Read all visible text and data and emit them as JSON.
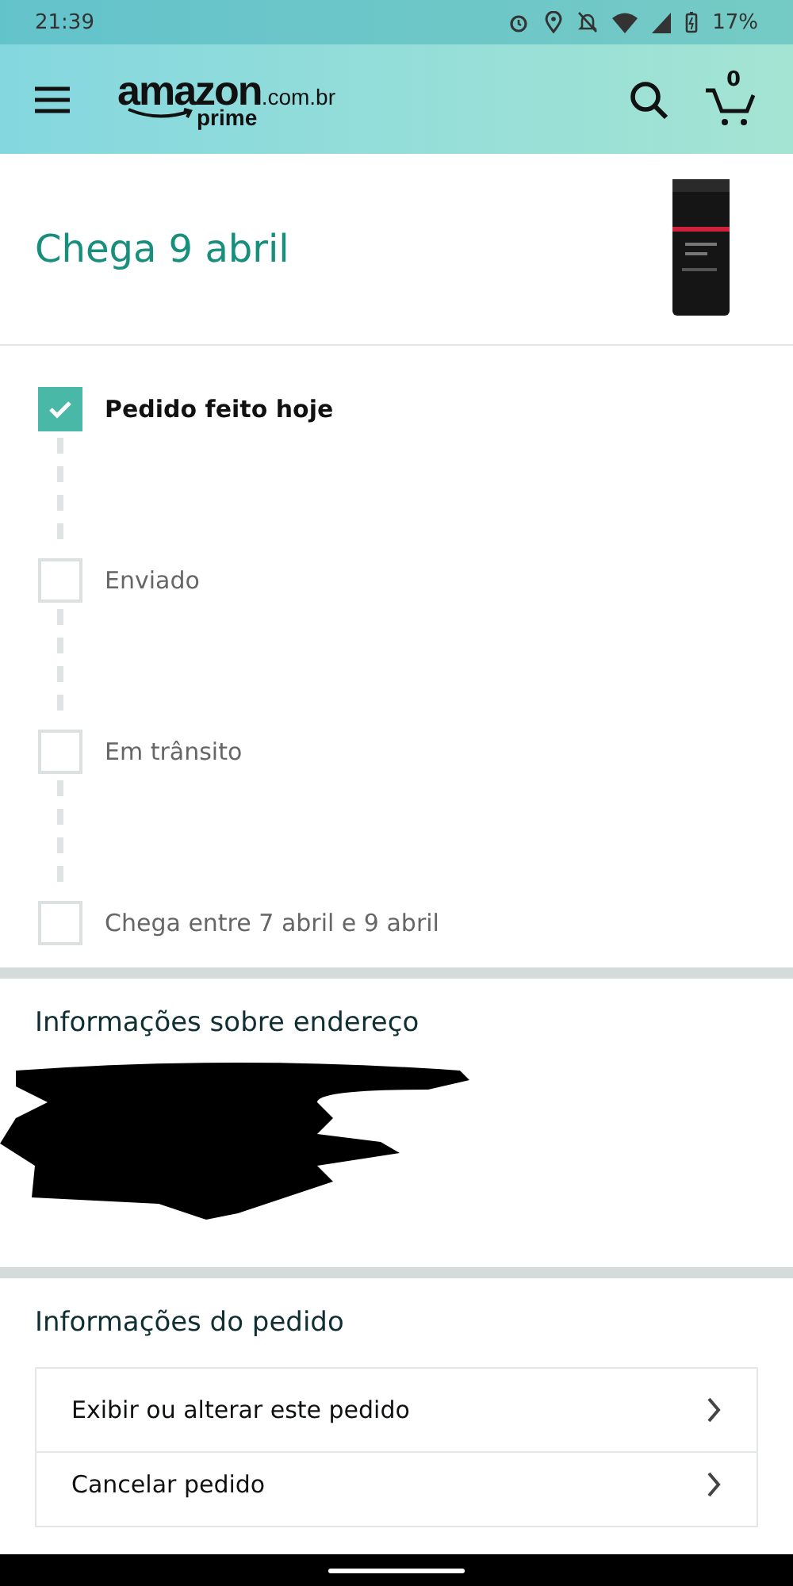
{
  "status_bar": {
    "time": "21:39",
    "battery": "17%"
  },
  "header": {
    "logo": {
      "word": "amazon",
      "domain": ".com.br",
      "tier": "prime"
    },
    "cart_count": "0"
  },
  "delivery": {
    "title": "Chega 9 abril"
  },
  "tracking": [
    {
      "label": "Pedido feito hoje",
      "checked": true
    },
    {
      "label": "Enviado",
      "checked": false
    },
    {
      "label": "Em trânsito",
      "checked": false
    },
    {
      "label": "Chega entre 7 abril e 9 abril",
      "checked": false
    }
  ],
  "address": {
    "title": "Informações sobre endereço"
  },
  "order": {
    "title": "Informações do pedido",
    "links": [
      "Exibir ou alterar este pedido",
      "Cancelar pedido"
    ]
  }
}
